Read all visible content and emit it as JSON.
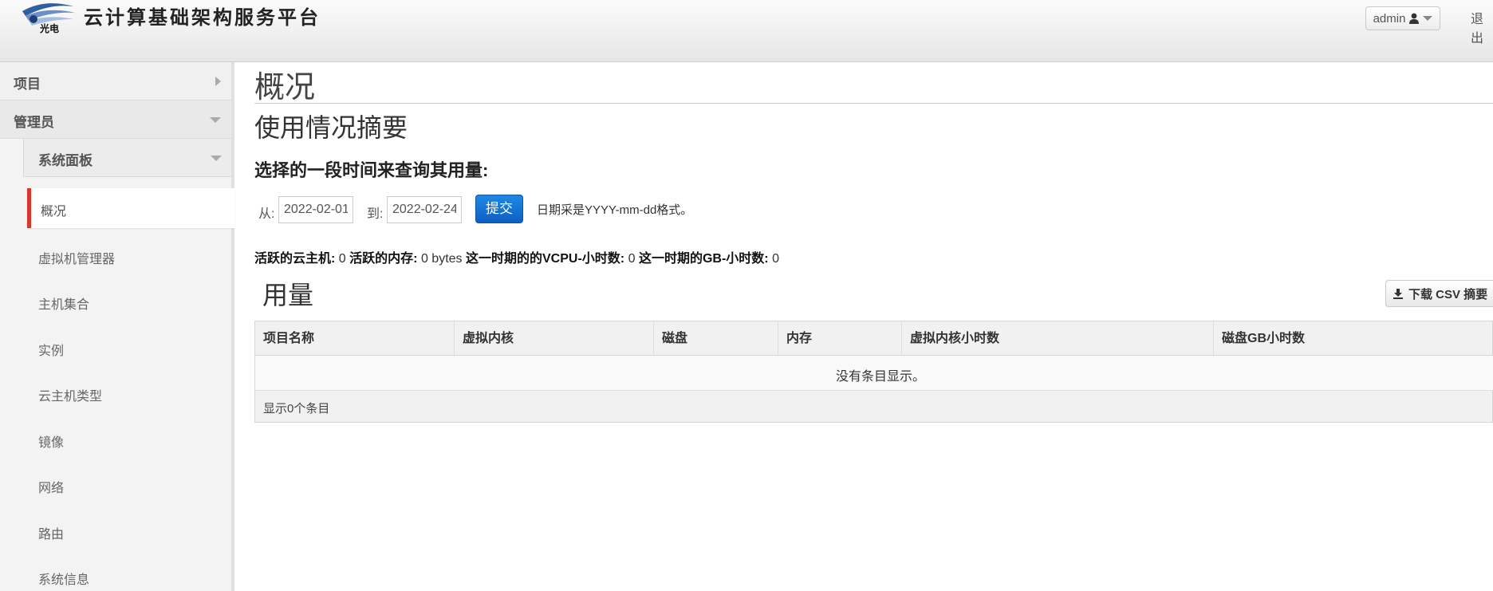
{
  "header": {
    "brand_title": "云计算基础架构服务平台",
    "logo_text": "光电",
    "user_label": "admin",
    "logout_label": "退出"
  },
  "sidebar": {
    "project_label": "项目",
    "admin_label": "管理员",
    "dashboard_label": "系统面板",
    "items": [
      {
        "label": "概况",
        "active": true
      },
      {
        "label": "虚拟机管理器"
      },
      {
        "label": "主机集合"
      },
      {
        "label": "实例"
      },
      {
        "label": "云主机类型"
      },
      {
        "label": "镜像"
      },
      {
        "label": "网络"
      },
      {
        "label": "路由"
      },
      {
        "label": "系统信息"
      }
    ]
  },
  "main": {
    "page_title": "概况",
    "section_title": "使用情况摘要",
    "query_heading": "选择的一段时间来查询其用量:",
    "from_label": "从:",
    "from_value": "2022-02-01",
    "to_label": "到:",
    "to_value": "2022-02-24",
    "submit_label": "提交",
    "date_hint": "日期采是YYYY-mm-dd格式。",
    "stats": {
      "active_instances_label": "活跃的云主机:",
      "active_instances_value": "0",
      "active_ram_label": "活跃的内存:",
      "active_ram_value": "0 bytes",
      "vcpu_hours_label": "这一时期的的VCPU-小时数:",
      "vcpu_hours_value": "0",
      "gb_hours_label": "这一时期的GB-小时数:",
      "gb_hours_value": "0"
    },
    "usage_title": "用量",
    "csv_button_label": "下载 CSV 摘要",
    "table": {
      "columns": [
        "项目名称",
        "虚拟内核",
        "磁盘",
        "内存",
        "虚拟内核小时数",
        "磁盘GB小时数"
      ],
      "empty_message": "没有条目显示。",
      "footer": "显示0个条目"
    }
  }
}
